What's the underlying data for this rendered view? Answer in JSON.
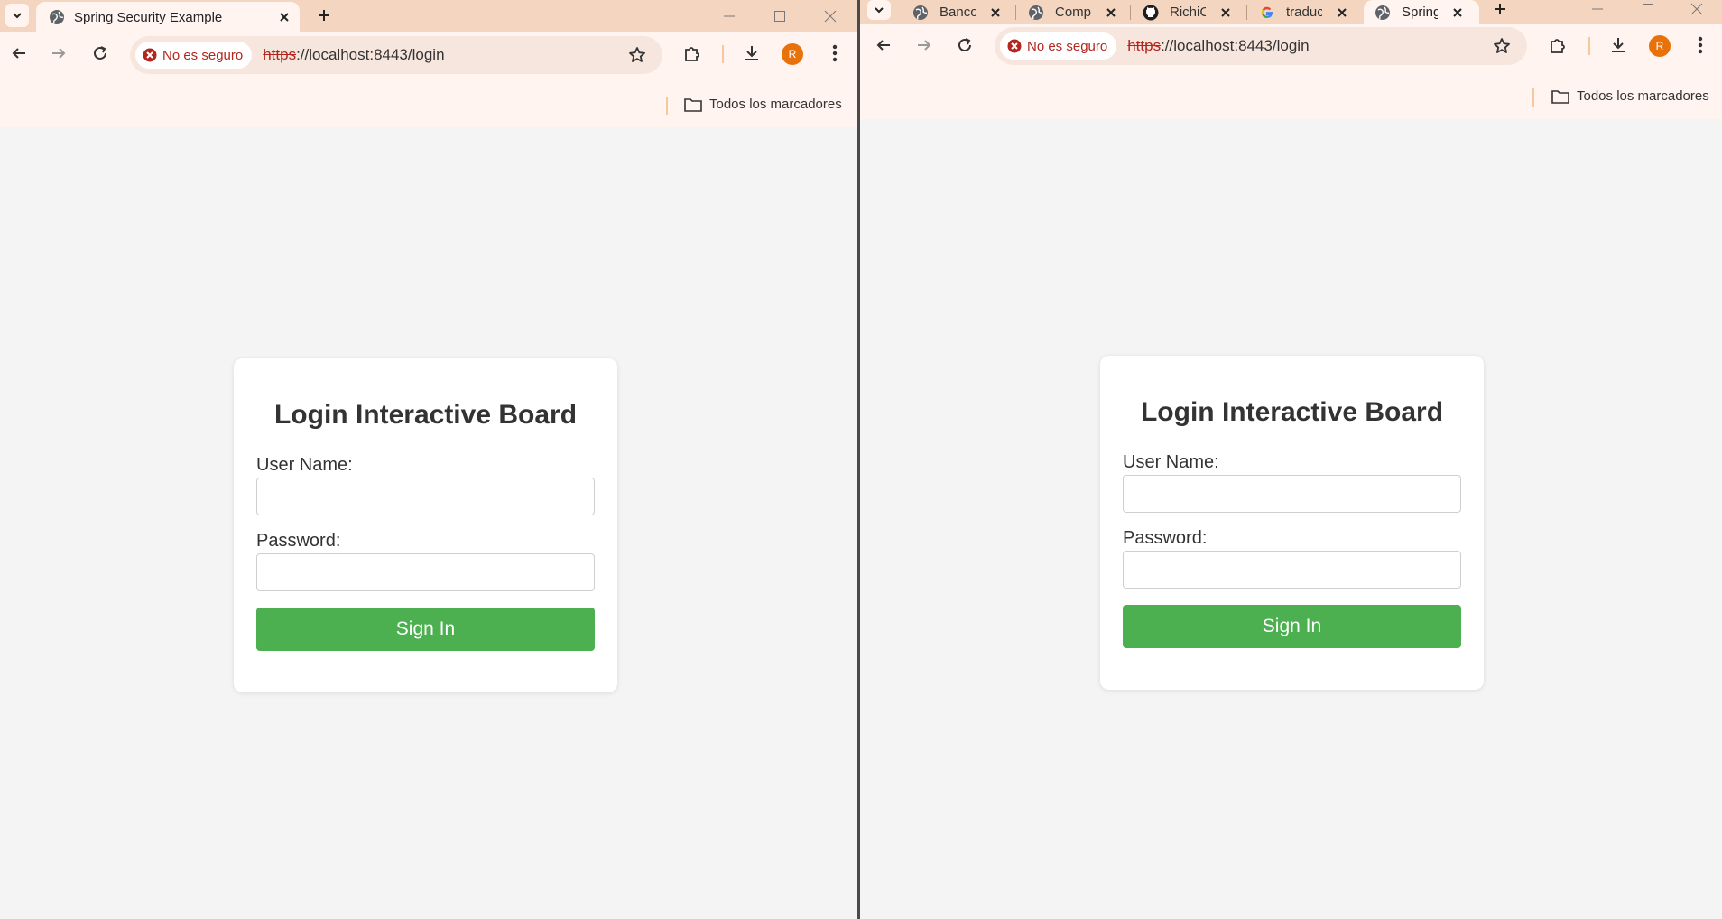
{
  "left_window": {
    "tab": {
      "title": "Spring Security Example"
    },
    "omnibox": {
      "security_label": "No es seguro",
      "url_scheme": "https",
      "url_rest": "://localhost:8443/login"
    },
    "profile_initial": "R",
    "bookmarks": {
      "label": "Todos los marcadores"
    },
    "login": {
      "title": "Login Interactive Board",
      "username_label": "User Name:",
      "password_label": "Password:",
      "username_value": "",
      "password_value": "",
      "submit_label": "Sign In"
    }
  },
  "right_window": {
    "tabs": [
      {
        "title": "Banco",
        "icon": "globe-icon"
      },
      {
        "title": "Comp",
        "icon": "globe-icon"
      },
      {
        "title": "RichiC",
        "icon": "github-icon"
      },
      {
        "title": "traduc",
        "icon": "google-icon"
      },
      {
        "title": "Spring",
        "icon": "globe-icon",
        "active": true
      }
    ],
    "omnibox": {
      "security_label": "No es seguro",
      "url_scheme": "https",
      "url_rest": "://localhost:8443/login"
    },
    "profile_initial": "R",
    "bookmarks": {
      "label": "Todos los marcadores"
    },
    "login": {
      "title": "Login Interactive Board",
      "username_label": "User Name:",
      "password_label": "Password:",
      "username_value": "",
      "password_value": "",
      "submit_label": "Sign In"
    }
  },
  "colors": {
    "tabstrip": "#f4d5c0",
    "toolbar": "#fff4ef",
    "page_background": "#f4f4f4",
    "signin_button": "#4caf50",
    "insecure_red": "#b3261e",
    "avatar": "#e8710a"
  }
}
